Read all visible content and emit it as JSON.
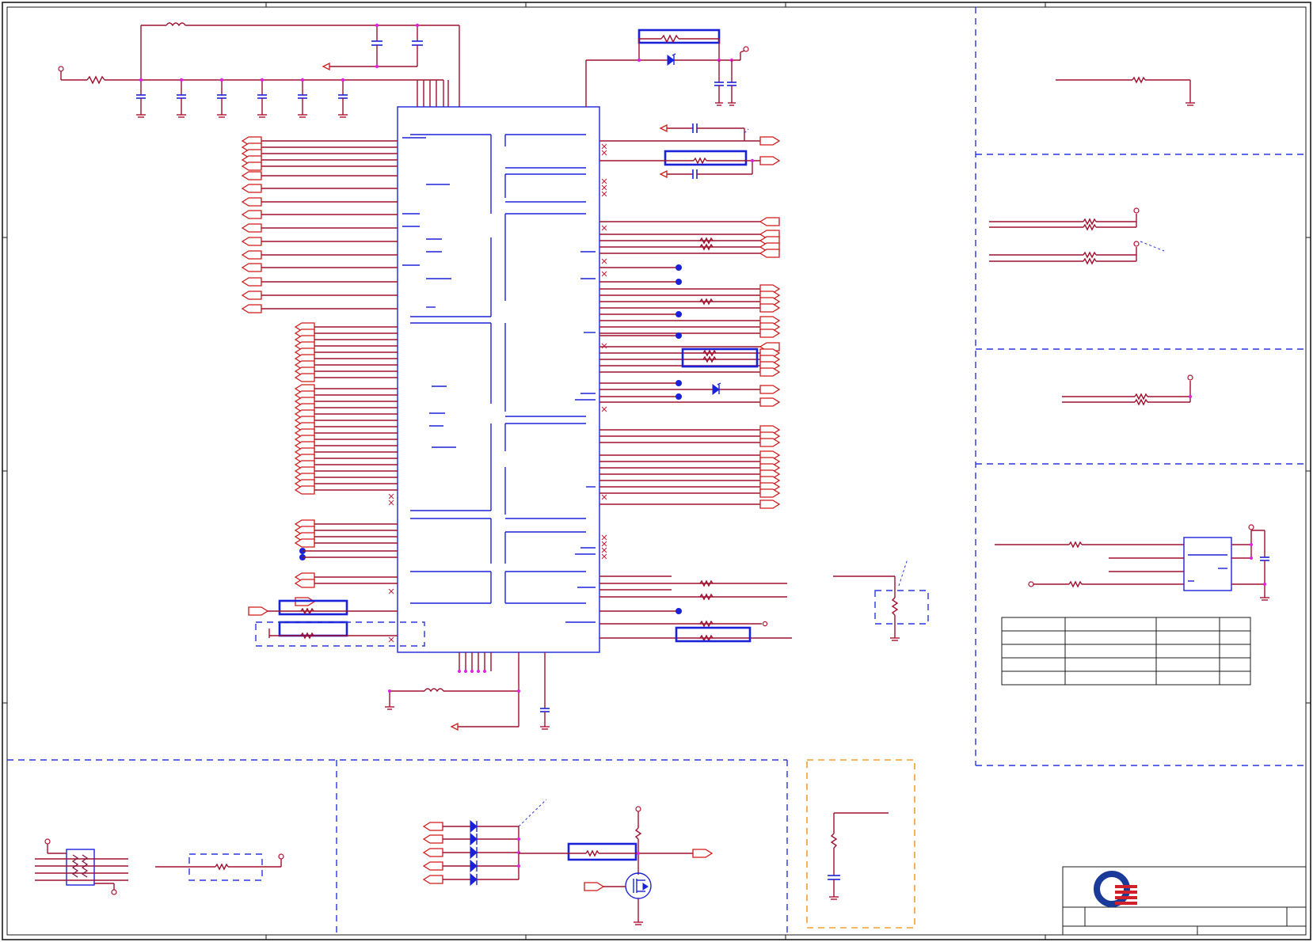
{
  "sheet": {
    "background": "#ffffff",
    "wire_color": "#a0102e",
    "component_color": "#1a22d8",
    "port_color": "#d01818",
    "junction_color": "#e020e0",
    "region_border_color": "#2a36e0",
    "highlight_region_color": "#f0a030"
  },
  "title_block": {
    "logo": "company-logo",
    "logo_colors": [
      "#1a3a9a",
      "#d0202a"
    ]
  },
  "ic": {
    "outline_color": "#1a22d8"
  },
  "table": {
    "rows": 5,
    "cols": 4
  }
}
